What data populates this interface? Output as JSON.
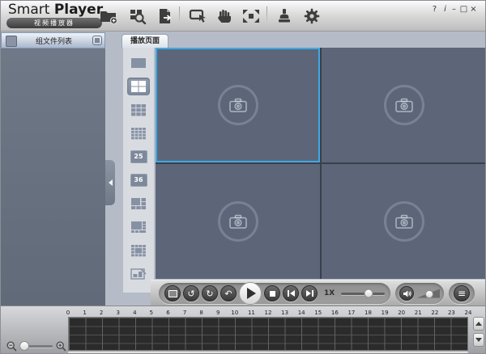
{
  "window": {
    "title_primary": "Smart",
    "title_secondary": "Player",
    "subtitle_badge": "视频播放器",
    "controls": {
      "help": "?",
      "info": "i",
      "minimize": "–",
      "maximize": "□",
      "close": "×"
    }
  },
  "toolbar": {
    "icons": [
      "open-folder-add",
      "smart-search",
      "export-file",
      "region-select",
      "hand-pan",
      "fullscreen",
      "watermark-stamp",
      "settings-gear"
    ]
  },
  "sidebar": {
    "title": "组文件列表"
  },
  "tab": {
    "label": "播放页面"
  },
  "layout_strip": {
    "selected_index": 1,
    "items": [
      "split-1",
      "split-4",
      "split-9",
      "split-16",
      "split-25",
      "split-36",
      "split-6",
      "split-8",
      "split-13",
      "split-custom"
    ],
    "labels": {
      "l25": "25",
      "l36": "36"
    }
  },
  "video_grid": {
    "panel_count": 4,
    "selected_panel": 0
  },
  "playback": {
    "speed_label": "1X",
    "speed_percent": 62,
    "volume_percent": 55,
    "glyphs": {
      "rewind": "↺",
      "loop": "↻",
      "undo": "↶",
      "more": "≡"
    }
  },
  "timeline": {
    "hour_labels": [
      "0",
      "1",
      "2",
      "3",
      "4",
      "5",
      "6",
      "7",
      "8",
      "9",
      "10",
      "11",
      "12",
      "13",
      "14",
      "15",
      "16",
      "17",
      "18",
      "19",
      "20",
      "21",
      "22",
      "23",
      "24"
    ],
    "zoom_percent": 12
  },
  "colors": {
    "accent_selection": "#3fa9e5",
    "panel_bg": "#5d6678",
    "sidebar_bg": "#667080"
  }
}
